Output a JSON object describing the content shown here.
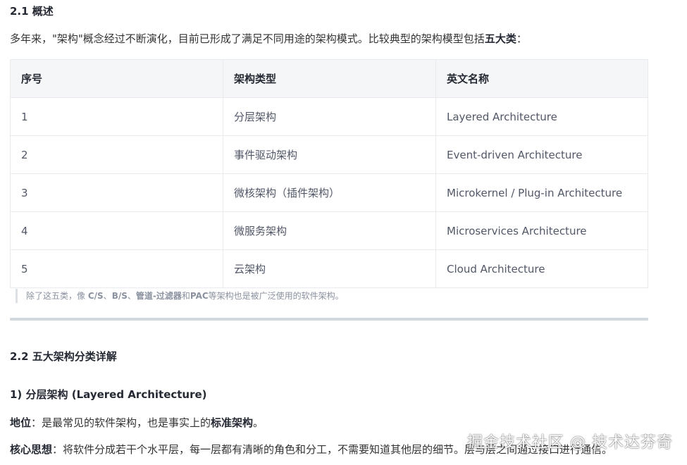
{
  "section_21": {
    "title": "2.1 概述",
    "intro_prefix": "多年来，\"架构\"概念经过不断演化，目前已形成了满足不同用途的架构模式。比较典型的架构模型包括",
    "intro_bold": "五大类",
    "intro_suffix": "："
  },
  "table": {
    "headers": [
      "序号",
      "架构类型",
      "英文名称"
    ],
    "rows": [
      [
        "1",
        "分层架构",
        "Layered Architecture"
      ],
      [
        "2",
        "事件驱动架构",
        "Event-driven Architecture"
      ],
      [
        "3",
        "微核架构（插件架构）",
        "Microkernel / Plug-in Architecture"
      ],
      [
        "4",
        "微服务架构",
        "Microservices Architecture"
      ],
      [
        "5",
        "云架构",
        "Cloud Architecture"
      ]
    ]
  },
  "note": {
    "p1": "除了这五类，像 ",
    "b1": "C/S",
    "p2": "、",
    "b2": "B/S",
    "p3": "、",
    "b3": "管道-过滤器",
    "p4": "和",
    "b4": "PAC",
    "p5": "等架构也是被广泛使用的软件架构。"
  },
  "section_22": {
    "title": "2.2 五大架构分类详解",
    "sub_label": "1) ",
    "sub_bold": "分层架构",
    "sub_rest": " (Layered Architecture)",
    "status_label": "地位",
    "status_text": "：是最常见的软件架构，也是事实上的",
    "status_bold": "标准架构",
    "status_end": "。",
    "core_label": "核心思想",
    "core_text": "：将软件分成若干个水平层，每一层都有清晰的角色和分工，不需要知道其他层的细节。层与层之间通过接口进行通信。"
  },
  "watermark": "掘金技术社区 @ 技术达芬奇"
}
